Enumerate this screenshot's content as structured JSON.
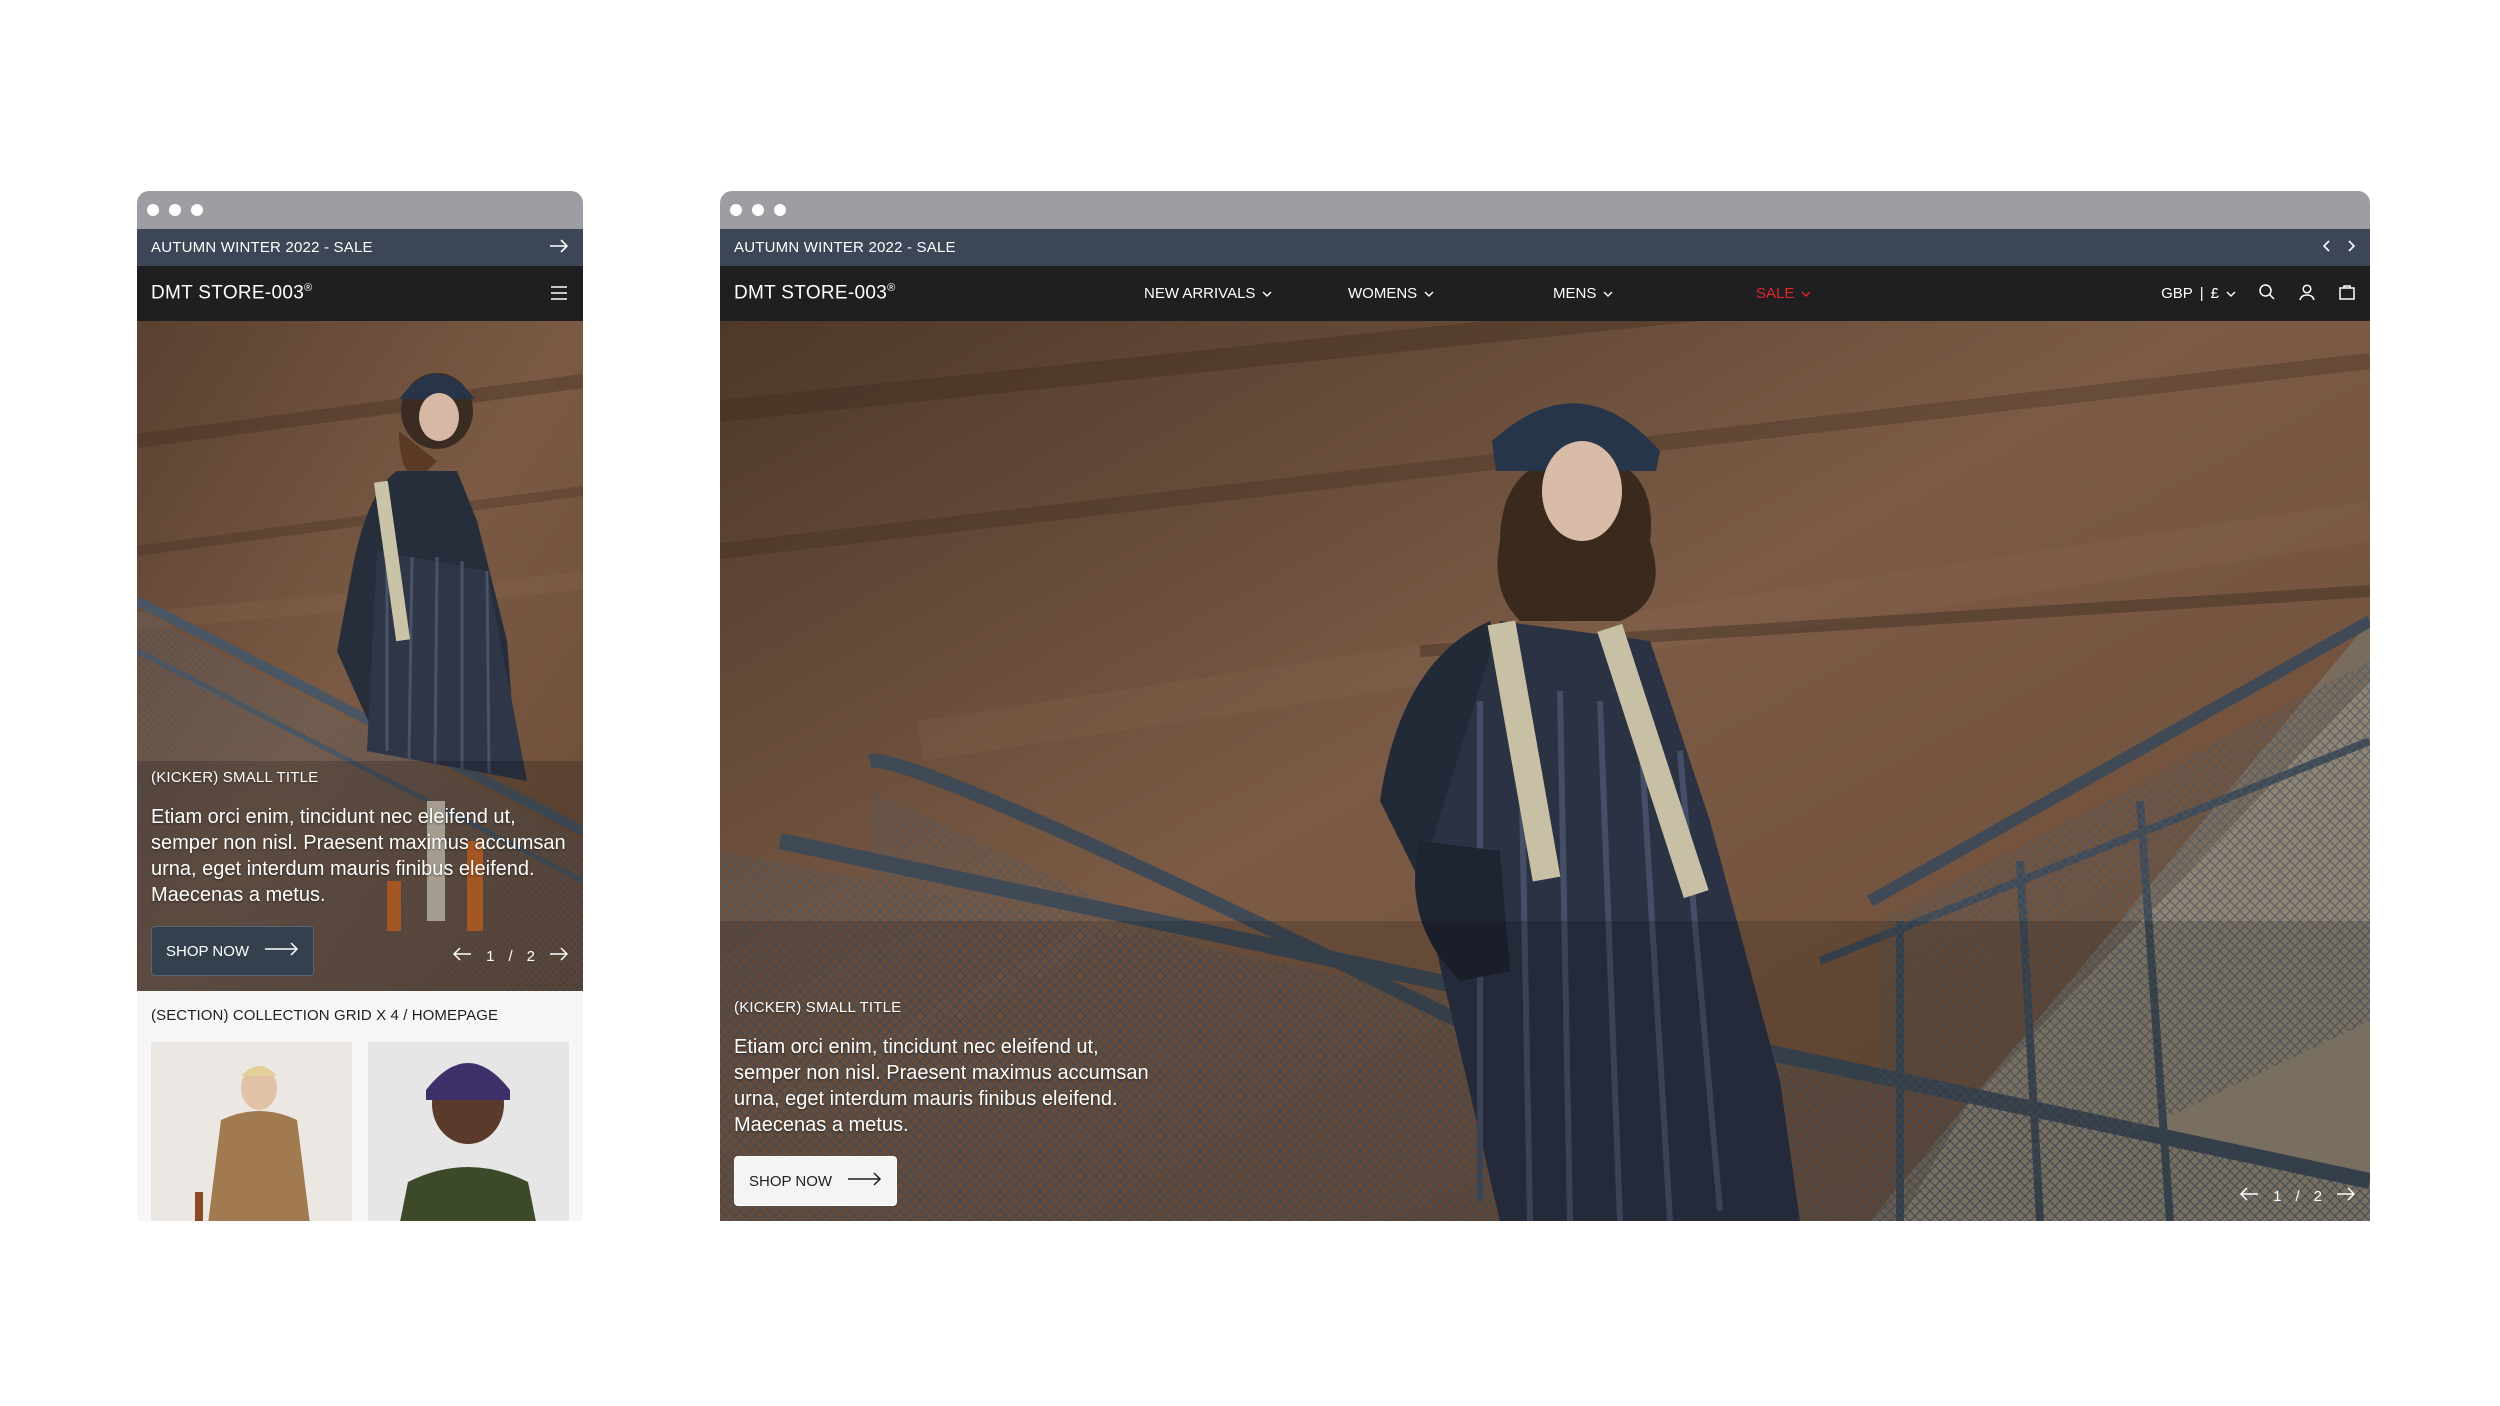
{
  "announcement": {
    "text": "AUTUMN WINTER 2022 - SALE"
  },
  "brand": {
    "logo": "DMT STORE-003",
    "mark": "®"
  },
  "nav": [
    {
      "label": "NEW ARRIVALS"
    },
    {
      "label": "WOMENS"
    },
    {
      "label": "MENS"
    },
    {
      "label": "SALE",
      "color": "#e0252c"
    }
  ],
  "currency": {
    "code": "GBP",
    "separator": "|",
    "symbol": "£"
  },
  "hero": {
    "kicker": "(KICKER) SMALL TITLE",
    "body": "Etiam orci enim, tincidunt nec eleifend ut, semper non nisl. Praesent maximus accumsan urna, eget interdum mauris finibus eleifend. Maecenas a  metus.",
    "cta": "SHOP NOW",
    "pager": {
      "current": "1",
      "sep": "/",
      "total": "2"
    }
  },
  "section": {
    "title": "(SECTION) COLLECTION GRID X 4 / HOMEPAGE"
  },
  "icons": {
    "arrow": "arrow-right-icon",
    "menu": "hamburger-icon",
    "search": "search-icon",
    "account": "user-icon",
    "bag": "bag-icon"
  },
  "colors": {
    "announce_bg": "#3c4656",
    "header_bg": "#1f1f21",
    "sale": "#e0252c",
    "chrome": "#9d9ea3"
  }
}
